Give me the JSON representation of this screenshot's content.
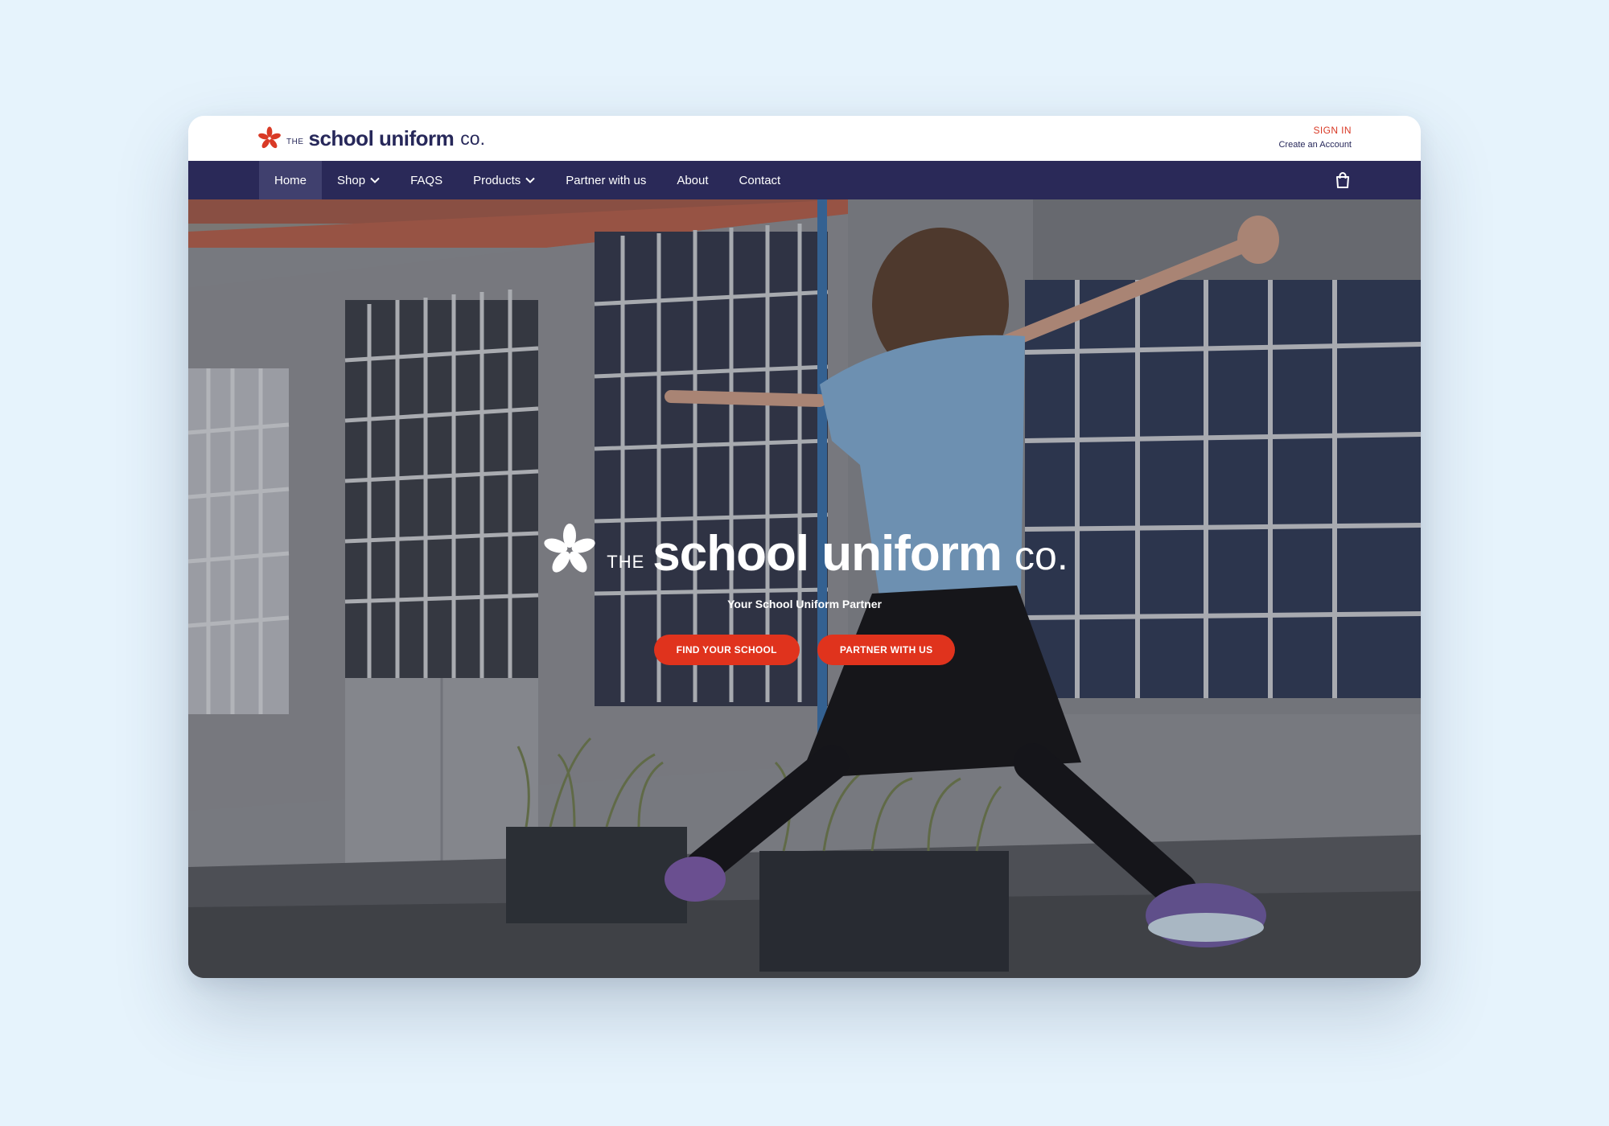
{
  "brand": {
    "the": "THE",
    "word1": "school uniform",
    "word2": "co."
  },
  "account": {
    "sign_in": "SIGN IN",
    "create_account": "Create an Account"
  },
  "nav": {
    "items": [
      {
        "label": "Home",
        "active": true,
        "dropdown": false
      },
      {
        "label": "Shop",
        "active": false,
        "dropdown": true
      },
      {
        "label": "FAQS",
        "active": false,
        "dropdown": false
      },
      {
        "label": "Products",
        "active": false,
        "dropdown": true
      },
      {
        "label": "Partner with us",
        "active": false,
        "dropdown": false
      },
      {
        "label": "About",
        "active": false,
        "dropdown": false
      },
      {
        "label": "Contact",
        "active": false,
        "dropdown": false
      }
    ],
    "cart_icon": "shopping-bag-icon"
  },
  "hero": {
    "logo": {
      "the": "THE",
      "word1": "school uniform",
      "word2": "co."
    },
    "tagline": "Your School Uniform Partner",
    "buttons": {
      "find_school": "FIND YOUR SCHOOL",
      "partner": "PARTNER WITH US"
    }
  },
  "colors": {
    "brand_navy": "#27285a",
    "accent_red": "#e0331d",
    "page_bg": "#e6f3fc"
  }
}
